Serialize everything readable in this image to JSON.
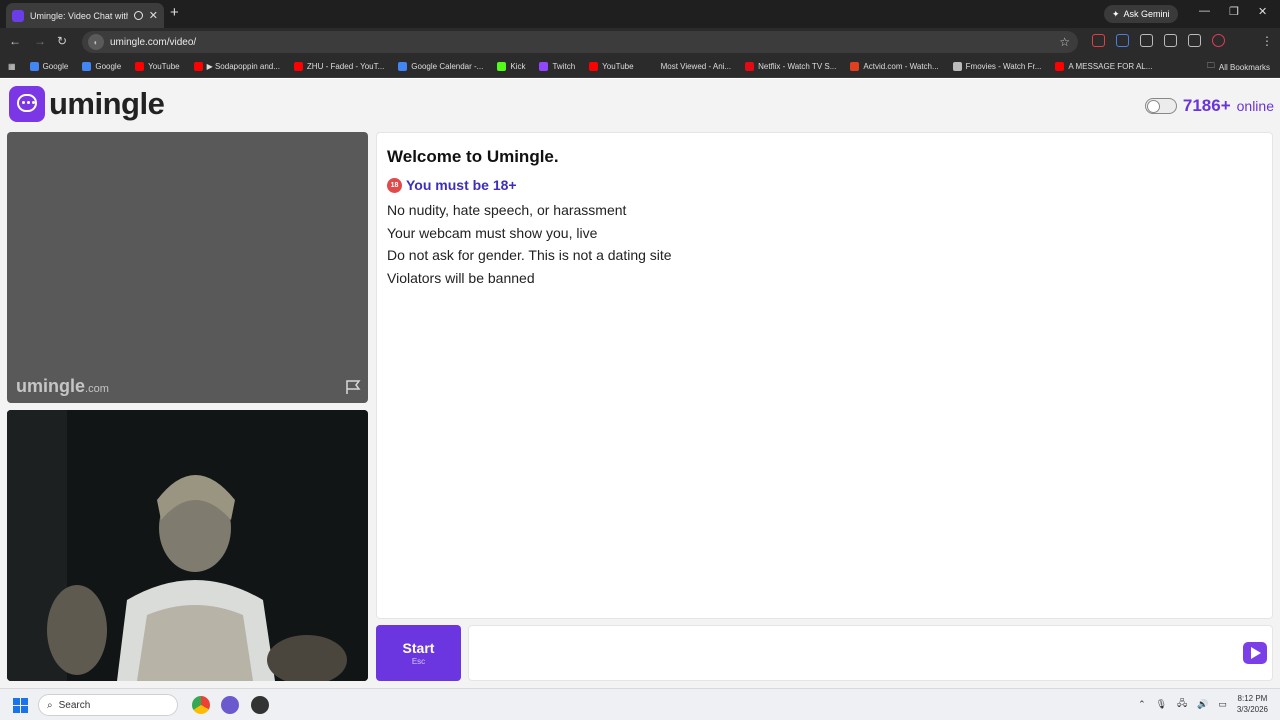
{
  "browser": {
    "tab_title": "Umingle: Video Chat with S",
    "url": "umingle.com/video/",
    "ask_gemini": "Ask Gemini",
    "bookmarks": [
      {
        "label": "Google",
        "color": "#4285f4"
      },
      {
        "label": "Google",
        "color": "#4285f4"
      },
      {
        "label": "YouTube",
        "color": "#ff0000"
      },
      {
        "label": "▶ Sodapoppin and...",
        "color": "#ff0000"
      },
      {
        "label": "ZHU - Faded - YouT...",
        "color": "#ff0000"
      },
      {
        "label": "Google Calendar -...",
        "color": "#4285f4"
      },
      {
        "label": "Kick",
        "color": "#53fc18"
      },
      {
        "label": "Twitch",
        "color": "#9146ff"
      },
      {
        "label": "YouTube",
        "color": "#ff0000"
      },
      {
        "label": "Most Viewed - Ani...",
        "color": "#2b2b2b"
      },
      {
        "label": "Netflix - Watch TV S...",
        "color": "#e50914"
      },
      {
        "label": "Actvid.com - Watch...",
        "color": "#e04020"
      },
      {
        "label": "Fmovies - Watch Fr...",
        "color": "#bbbbbb"
      },
      {
        "label": "A MESSAGE FOR AL...",
        "color": "#ff0000"
      }
    ],
    "all_bookmarks": "All Bookmarks"
  },
  "site": {
    "logo_text": "umingle",
    "online_count": "7186+",
    "online_label": "online",
    "watermark_name": "umingle",
    "watermark_tld": ".com"
  },
  "chat": {
    "welcome": "Welcome to Umingle.",
    "age_badge": "18",
    "age_notice": "You must be 18+",
    "rules": [
      "No nudity, hate speech, or harassment",
      "Your webcam must show you, live",
      "Do not ask for gender. This is not a dating site",
      "Violators will be banned"
    ]
  },
  "controls": {
    "start_label": "Start",
    "start_key": "Esc"
  },
  "taskbar": {
    "search_placeholder": "Search",
    "time": "8:12 PM",
    "date": "3/3/2026"
  },
  "colors": {
    "brand": "#6b35e0"
  }
}
